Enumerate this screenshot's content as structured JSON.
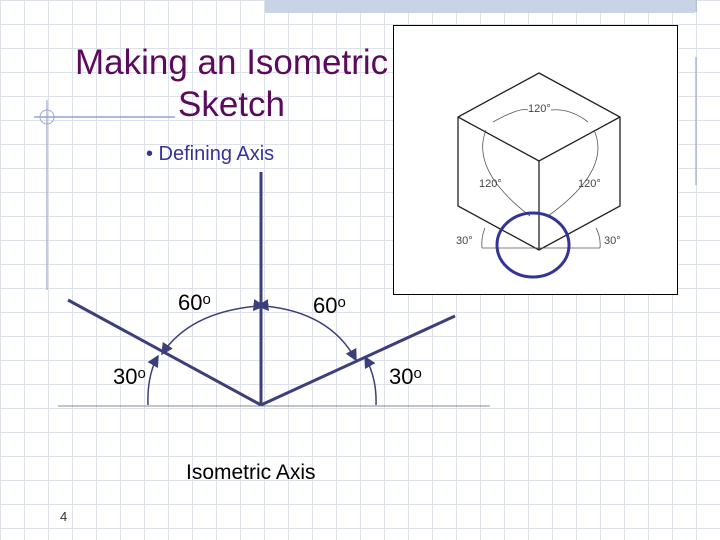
{
  "slide": {
    "title_line1": "Making an Isometric",
    "title_line2": "Sketch",
    "bullet": "• Defining Axis",
    "angles": {
      "top_left": "60",
      "top_right": "60",
      "bottom_left": "30",
      "bottom_right": "30",
      "degree_symbol": "o"
    },
    "caption": "Isometric Axis",
    "page_number": "4"
  },
  "figure": {
    "label_top": "120°",
    "label_left": "120°",
    "label_right": "120°",
    "label_bottom_left": "30°",
    "label_bottom_right": "30°"
  },
  "colors": {
    "title": "#5c0a5c",
    "accent": "#333399",
    "axis": "#3c3f7a"
  }
}
